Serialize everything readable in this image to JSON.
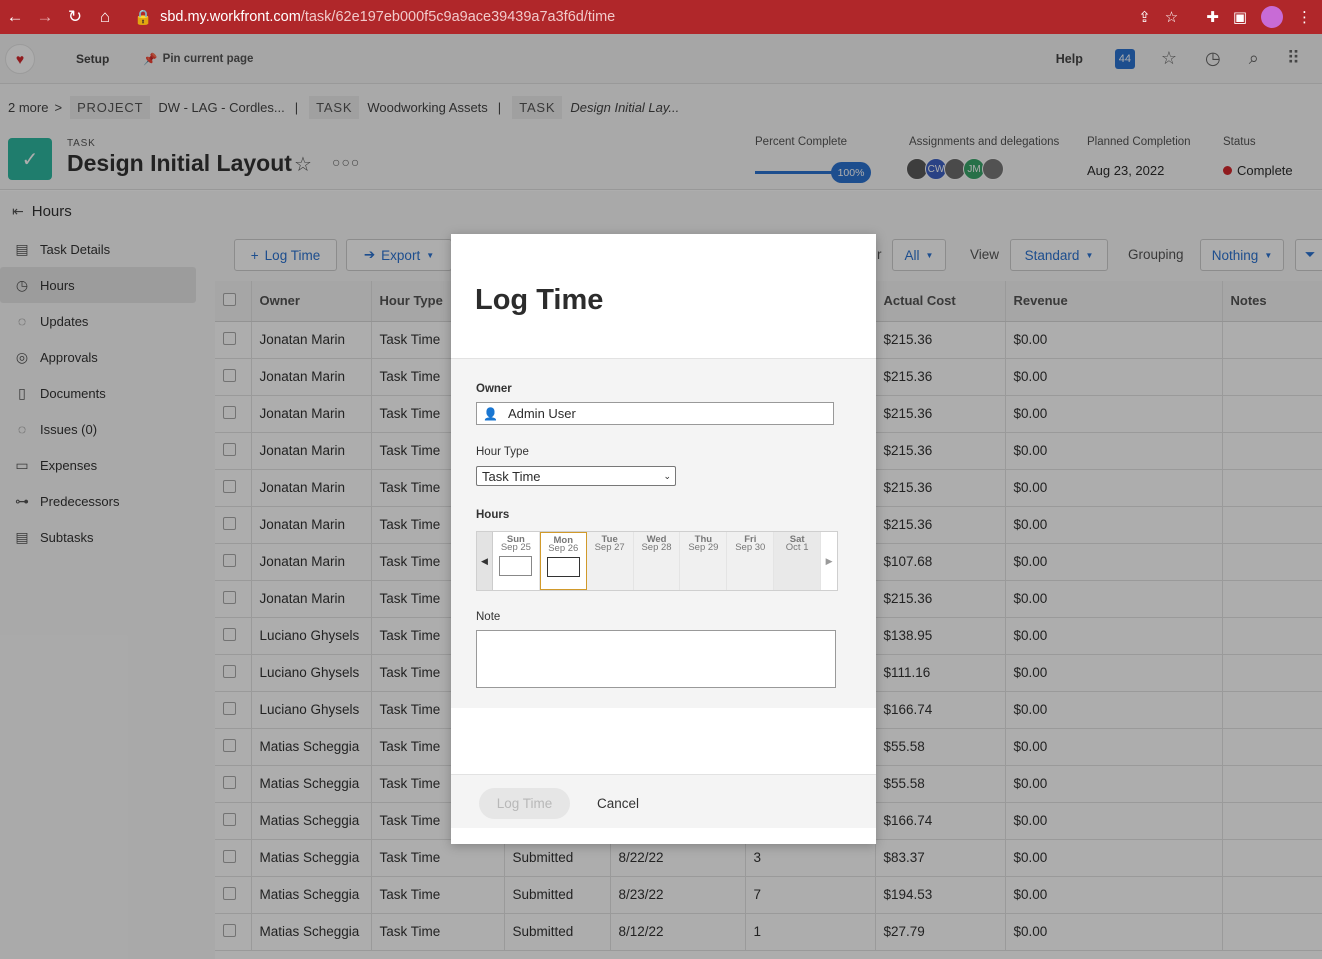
{
  "browser": {
    "url_host": "sbd.my.workfront.com",
    "url_path": "/task/62e197eb000f5c9a9ace39439a7a3f6d/time"
  },
  "appbar": {
    "setup": "Setup",
    "pin": "Pin current page",
    "help": "Help",
    "badge": "44"
  },
  "breadcrumb": {
    "more": "2 more",
    "tag_project": "PROJECT",
    "project": "DW - LAG - Cordles...",
    "tag_task1": "TASK",
    "task1": "Woodworking Assets",
    "tag_task2": "TASK",
    "current": "Design Initial Lay..."
  },
  "task": {
    "label": "TASK",
    "title": "Design Initial Layout",
    "percent_label": "Percent Complete",
    "percent_value": "100%",
    "assign_label": "Assignments and delegations",
    "avatars": [
      {
        "initials": "",
        "color": "#5a5a5a"
      },
      {
        "initials": "CW",
        "color": "#3f62c4"
      },
      {
        "initials": "",
        "color": "#6e6e6e"
      },
      {
        "initials": "JM",
        "color": "#3aa56b"
      },
      {
        "initials": "",
        "color": "#7a7a7a"
      }
    ],
    "planned_label": "Planned Completion",
    "planned_value": "Aug 23, 2022",
    "status_label": "Status",
    "status_value": "Complete"
  },
  "section": {
    "title": "Hours"
  },
  "sidebar": {
    "items": [
      {
        "label": "Task Details",
        "icon": "document-icon"
      },
      {
        "label": "Hours",
        "icon": "clock-icon"
      },
      {
        "label": "Updates",
        "icon": "chat-icon"
      },
      {
        "label": "Approvals",
        "icon": "check-circle-icon"
      },
      {
        "label": "Documents",
        "icon": "file-icon"
      },
      {
        "label": "Issues (0)",
        "icon": "issue-icon"
      },
      {
        "label": "Expenses",
        "icon": "money-icon"
      },
      {
        "label": "Predecessors",
        "icon": "predecessor-icon"
      },
      {
        "label": "Subtasks",
        "icon": "subtask-icon"
      }
    ]
  },
  "toolbar": {
    "log_time": "Log Time",
    "export": "Export",
    "filter_all": "All",
    "view_label": "View",
    "view_value": "Standard",
    "grouping_label": "Grouping",
    "grouping_value": "Nothing",
    "partial_r": "r"
  },
  "table": {
    "headers": [
      "Owner",
      "Hour Type",
      "",
      "",
      "",
      "Actual Cost",
      "Revenue",
      "Notes"
    ],
    "rows": [
      {
        "owner": "Jonatan Marin",
        "type": "Task Time",
        "status": "",
        "date": "",
        "hours": "",
        "cost": "$215.36",
        "revenue": "$0.00"
      },
      {
        "owner": "Jonatan Marin",
        "type": "Task Time",
        "status": "",
        "date": "",
        "hours": "",
        "cost": "$215.36",
        "revenue": "$0.00"
      },
      {
        "owner": "Jonatan Marin",
        "type": "Task Time",
        "status": "",
        "date": "",
        "hours": "",
        "cost": "$215.36",
        "revenue": "$0.00"
      },
      {
        "owner": "Jonatan Marin",
        "type": "Task Time",
        "status": "",
        "date": "",
        "hours": "",
        "cost": "$215.36",
        "revenue": "$0.00"
      },
      {
        "owner": "Jonatan Marin",
        "type": "Task Time",
        "status": "",
        "date": "",
        "hours": "",
        "cost": "$215.36",
        "revenue": "$0.00"
      },
      {
        "owner": "Jonatan Marin",
        "type": "Task Time",
        "status": "",
        "date": "",
        "hours": "",
        "cost": "$215.36",
        "revenue": "$0.00"
      },
      {
        "owner": "Jonatan Marin",
        "type": "Task Time",
        "status": "",
        "date": "",
        "hours": "",
        "cost": "$107.68",
        "revenue": "$0.00"
      },
      {
        "owner": "Jonatan Marin",
        "type": "Task Time",
        "status": "",
        "date": "",
        "hours": "",
        "cost": "$215.36",
        "revenue": "$0.00"
      },
      {
        "owner": "Luciano Ghysels",
        "type": "Task Time",
        "status": "",
        "date": "",
        "hours": "",
        "cost": "$138.95",
        "revenue": "$0.00"
      },
      {
        "owner": "Luciano Ghysels",
        "type": "Task Time",
        "status": "",
        "date": "",
        "hours": "",
        "cost": "$111.16",
        "revenue": "$0.00"
      },
      {
        "owner": "Luciano Ghysels",
        "type": "Task Time",
        "status": "",
        "date": "",
        "hours": "",
        "cost": "$166.74",
        "revenue": "$0.00"
      },
      {
        "owner": "Matias Scheggia",
        "type": "Task Time",
        "status": "",
        "date": "",
        "hours": "",
        "cost": "$55.58",
        "revenue": "$0.00"
      },
      {
        "owner": "Matias Scheggia",
        "type": "Task Time",
        "status": "",
        "date": "",
        "hours": "",
        "cost": "$55.58",
        "revenue": "$0.00"
      },
      {
        "owner": "Matias Scheggia",
        "type": "Task Time",
        "status": "",
        "date": "",
        "hours": "",
        "cost": "$166.74",
        "revenue": "$0.00"
      },
      {
        "owner": "Matias Scheggia",
        "type": "Task Time",
        "status": "Submitted",
        "date": "8/22/22",
        "hours": "3",
        "cost": "$83.37",
        "revenue": "$0.00"
      },
      {
        "owner": "Matias Scheggia",
        "type": "Task Time",
        "status": "Submitted",
        "date": "8/23/22",
        "hours": "7",
        "cost": "$194.53",
        "revenue": "$0.00"
      },
      {
        "owner": "Matias Scheggia",
        "type": "Task Time",
        "status": "Submitted",
        "date": "8/12/22",
        "hours": "1",
        "cost": "$27.79",
        "revenue": "$0.00"
      }
    ]
  },
  "modal": {
    "title": "Log Time",
    "owner_label": "Owner",
    "owner_value": "Admin User",
    "hour_type_label": "Hour Type",
    "hour_type_value": "Task Time",
    "hours_label": "Hours",
    "days": [
      {
        "dn": "Sun",
        "date": "Sep 25"
      },
      {
        "dn": "Mon",
        "date": "Sep 26"
      },
      {
        "dn": "Tue",
        "date": "Sep 27"
      },
      {
        "dn": "Wed",
        "date": "Sep 28"
      },
      {
        "dn": "Thu",
        "date": "Sep 29"
      },
      {
        "dn": "Fri",
        "date": "Sep 30"
      },
      {
        "dn": "Sat",
        "date": "Oct 1"
      }
    ],
    "note_label": "Note",
    "log_button": "Log Time",
    "cancel_button": "Cancel"
  }
}
